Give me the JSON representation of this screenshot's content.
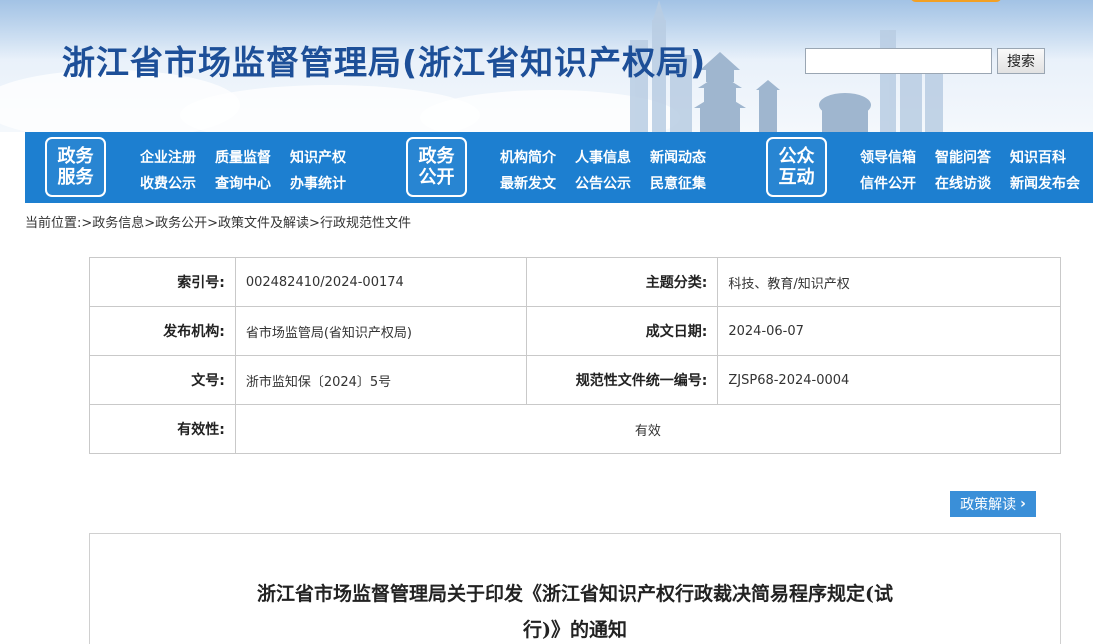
{
  "header": {
    "site_title": "浙江省市场监督管理局(浙江省知识产权局)",
    "search": {
      "placeholder": "",
      "button_label": "搜索"
    }
  },
  "nav": {
    "groups": [
      {
        "box_line1": "政务",
        "box_line2": "服务",
        "links": [
          [
            "企业注册",
            "质量监督",
            "知识产权"
          ],
          [
            "收费公示",
            "查询中心",
            "办事统计"
          ]
        ]
      },
      {
        "box_line1": "政务",
        "box_line2": "公开",
        "links": [
          [
            "机构简介",
            "人事信息",
            "新闻动态"
          ],
          [
            "最新发文",
            "公告公示",
            "民意征集"
          ]
        ]
      },
      {
        "box_line1": "公众",
        "box_line2": "互动",
        "links": [
          [
            "领导信箱",
            "智能问答",
            "知识百科"
          ],
          [
            "信件公开",
            "在线访谈",
            "新闻发布会"
          ]
        ]
      }
    ]
  },
  "breadcrumb": "当前位置:>政务信息>政务公开>政策文件及解读>行政规范性文件",
  "info": {
    "index_label": "索引号:",
    "index_value": "002482410/2024-00174",
    "topic_label": "主题分类:",
    "topic_value": "科技、教育/知识产权",
    "publisher_label": "发布机构:",
    "publisher_value": "省市场监管局(省知识产权局)",
    "date_label": "成文日期:",
    "date_value": "2024-06-07",
    "docno_label": "文号:",
    "docno_value": "浙市监知保〔2024〕5号",
    "unified_label": "规范性文件统一编号:",
    "unified_value": "ZJSP68-2024-0004",
    "validity_label": "有效性:",
    "validity_value": "有效"
  },
  "policy_button": {
    "label": "政策解读"
  },
  "article": {
    "title_line1": "浙江省市场监督管理局关于印发《浙江省知识产权行政裁决简易程序规定(试",
    "title_line2": "行)》的通知"
  },
  "colors": {
    "nav_bg": "#1d7fd0",
    "title": "#1d4f98",
    "button": "#3a8fd8"
  }
}
